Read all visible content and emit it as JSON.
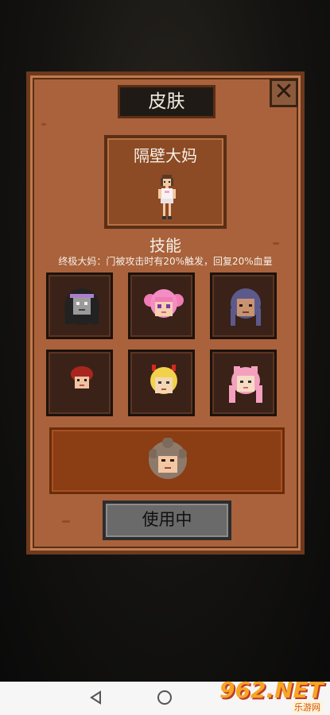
{
  "panel": {
    "title": "皮肤",
    "close_icon": "close-icon"
  },
  "preview": {
    "name": "隔壁大妈"
  },
  "skill": {
    "title": "技能",
    "description": "终极大妈：门被攻击时有20%触发，回复20%血量"
  },
  "skins": [
    {
      "icon": "dark-haired-headphones-face"
    },
    {
      "icon": "pink-twin-hair-face"
    },
    {
      "icon": "long-braided-hair-face"
    },
    {
      "icon": "red-hair-face"
    },
    {
      "icon": "blonde-red-horns-face"
    },
    {
      "icon": "pink-cat-ear-face"
    }
  ],
  "selected_skin": {
    "icon": "curly-brown-hair-face"
  },
  "use_button": {
    "label": "使用中"
  },
  "navbar": {
    "back_icon": "back-triangle-icon",
    "home_icon": "home-circle-icon"
  },
  "watermark": {
    "logo": "962.NET",
    "sub": "乐游网"
  }
}
